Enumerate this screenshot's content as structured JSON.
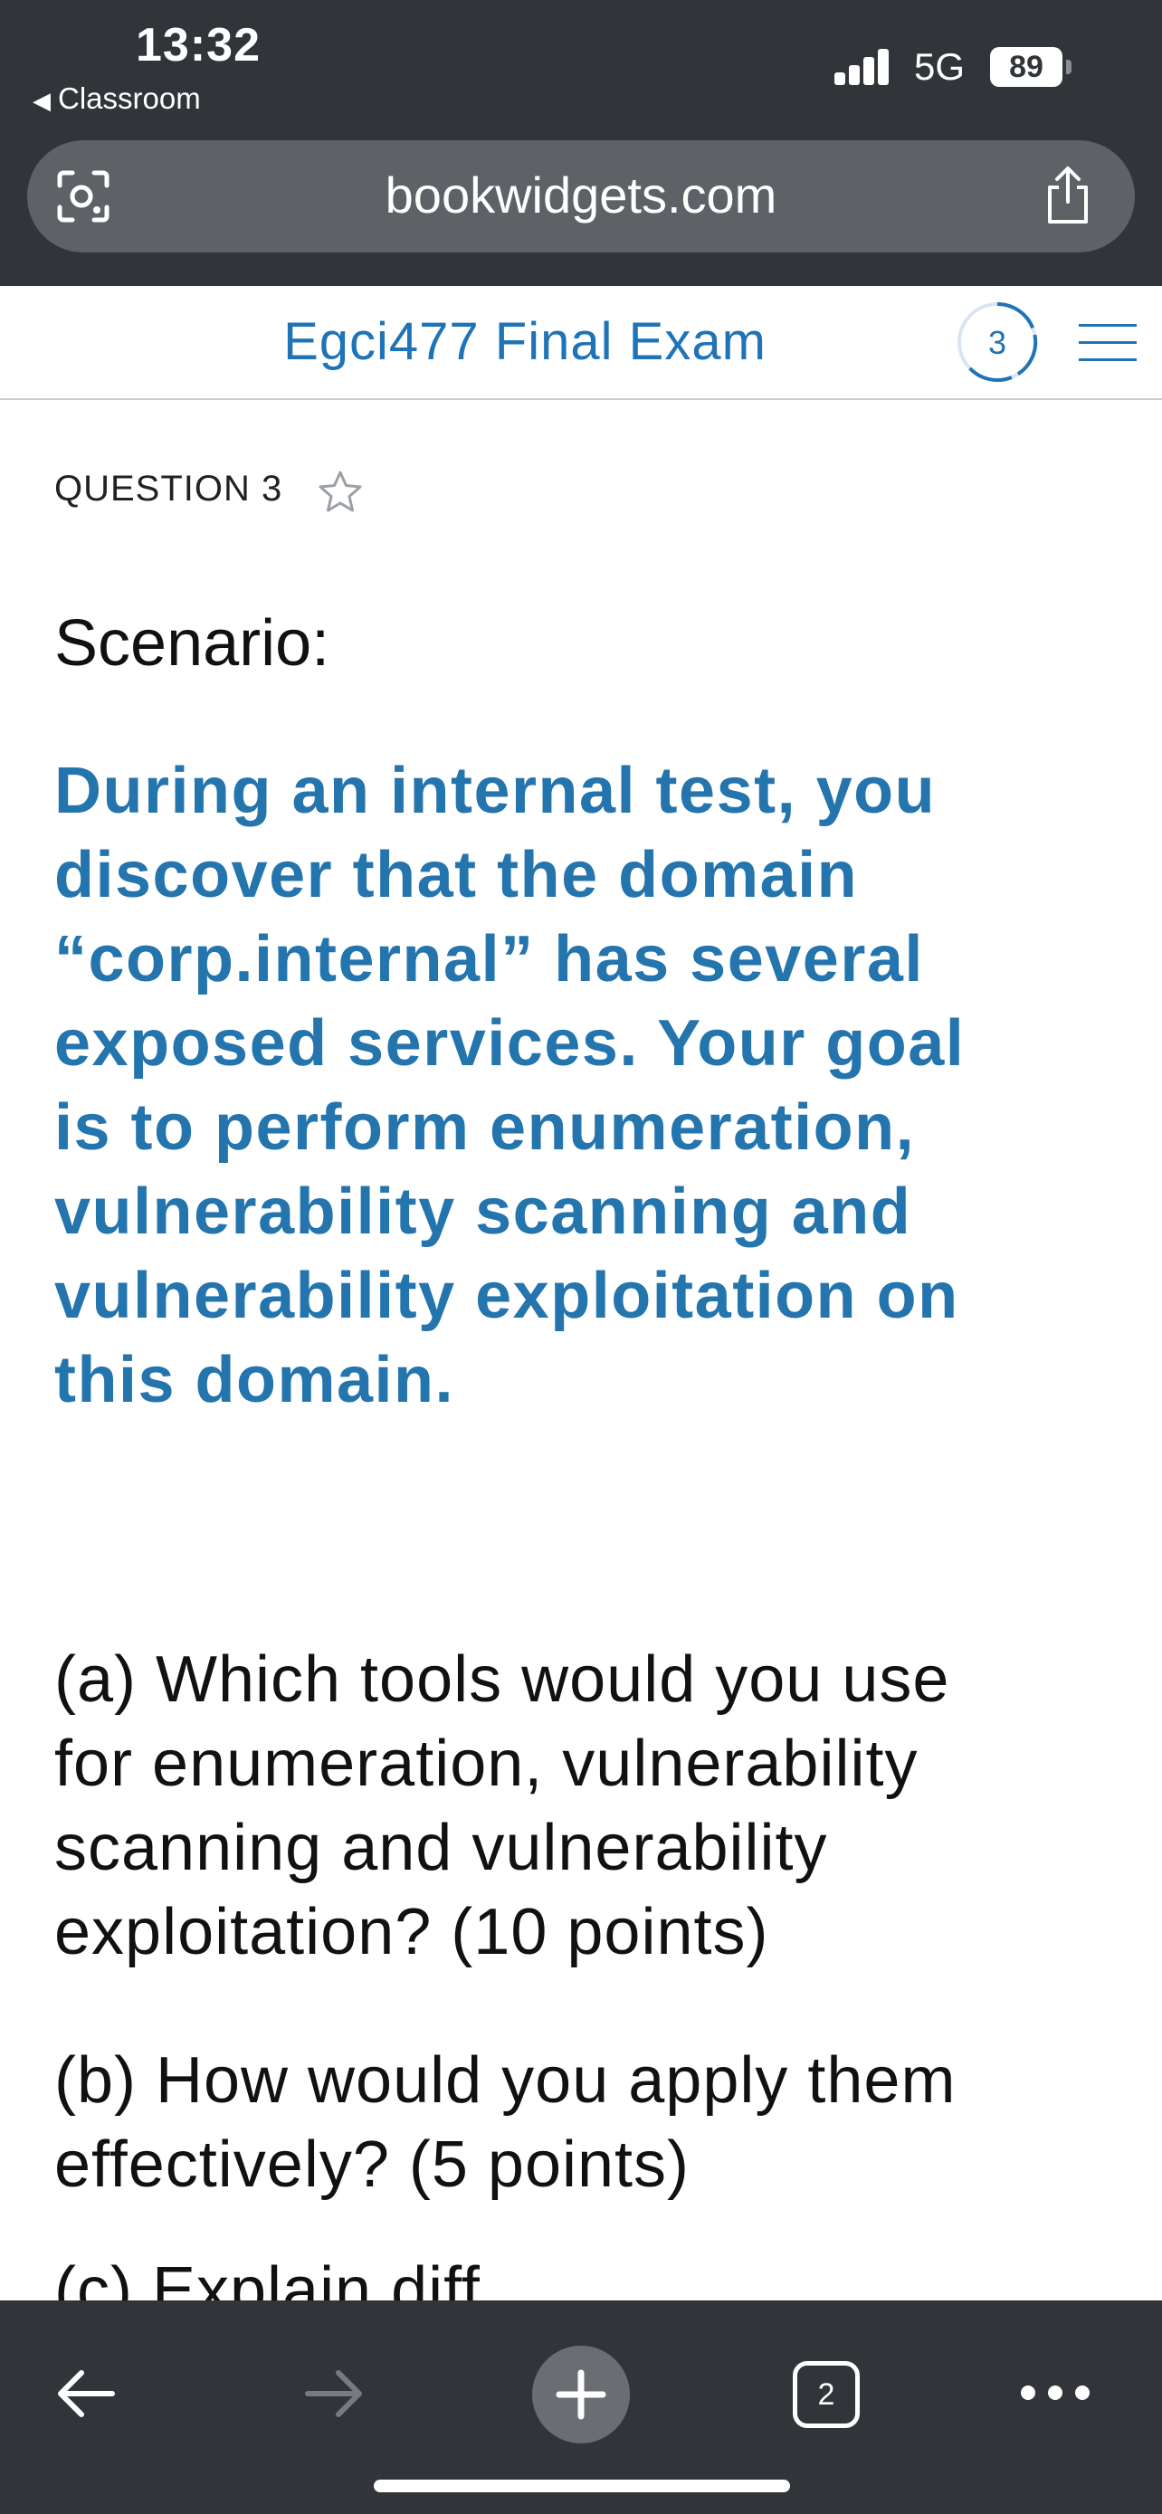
{
  "status_bar": {
    "time": "13:32",
    "back_app": "Classroom",
    "network": "5G",
    "battery": "89"
  },
  "browser": {
    "url": "bookwidgets.com",
    "lens_icon": "camera-lens-icon",
    "share_icon": "share-icon"
  },
  "header": {
    "title": "Egci477 Final Exam",
    "progress_number": "3",
    "menu_icon": "hamburger-menu-icon",
    "accent_color": "#1f73b7"
  },
  "question": {
    "label": "QUESTION 3",
    "star_icon": "star-outline-icon",
    "scenario_heading": "Scenario:",
    "scenario_lines": [
      "During an internal test, you",
      "discover that the domain",
      "“corp.internal” has several",
      "exposed services. Your goal",
      "is to perform enumeration,",
      "vulnerability scanning and",
      "vulnerability exploitation on",
      "this domain."
    ],
    "part_a_lines": [
      "(a) Which tools would you use",
      "for enumeration, vulnerability",
      "scanning and vulnerability",
      "exploitation? (10 points)"
    ],
    "part_b_lines": [
      "(b) How would you apply them",
      "effectively? (5 points)"
    ],
    "part_c_partial": "(c) Explain diff"
  },
  "bottom_bar": {
    "back_icon": "arrow-left-icon",
    "forward_icon": "arrow-right-icon",
    "new_tab_icon": "plus-icon",
    "tab_count": "2",
    "more_icon": "ellipsis-icon"
  }
}
